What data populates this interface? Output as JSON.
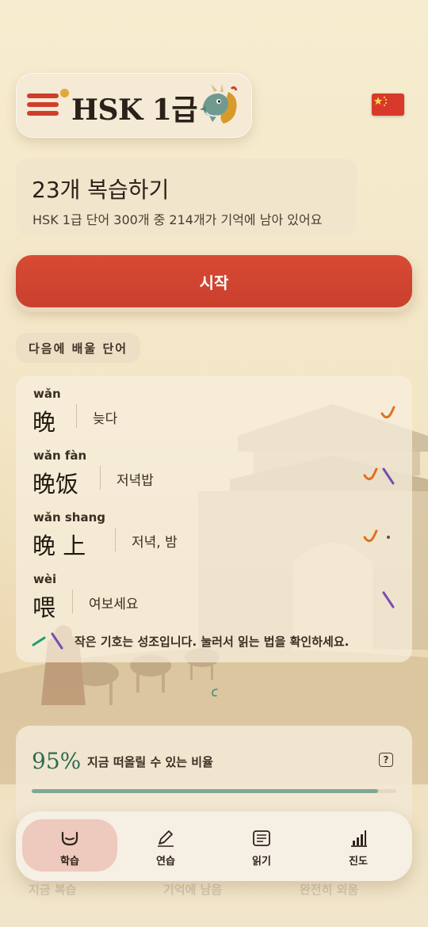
{
  "header": {
    "app_title": "HSK 1급",
    "menu_icon": "menu-icon",
    "mascot_icon": "dragon-icon",
    "language_flag": "china-flag-icon"
  },
  "review": {
    "title": "23개 복습하기",
    "subtitle": "HSK 1급 단어 300개 중 214개가 기억에 남아 있어요"
  },
  "start_button": {
    "label": "시작"
  },
  "next_words": {
    "heading": "다음에 배울 단어",
    "words": [
      {
        "pinyin": "wǎn",
        "hanzi": "晚",
        "meaning": "늦다",
        "tones": [
          "third"
        ]
      },
      {
        "pinyin": "wǎn fàn",
        "hanzi": "晚饭",
        "meaning": "저녁밥",
        "tones": [
          "third",
          "fourth"
        ]
      },
      {
        "pinyin": "wǎn shang",
        "hanzi": "晚 上",
        "meaning": "저녁, 밤",
        "tones": [
          "third",
          "neutral"
        ]
      },
      {
        "pinyin": "wèi",
        "hanzi": "喂",
        "meaning": "여보세요",
        "tones": [
          "fourth"
        ]
      }
    ],
    "legend": "작은 기호는 성조입니다. 눌러서 읽는 법을 확인하세요."
  },
  "recall": {
    "percent": "95%",
    "label": "지금 떠올릴 수 있는 비율",
    "progress": 0.95
  },
  "ghost_labels": [
    "지금 복습",
    "기억에 남음",
    "완전히 외움"
  ],
  "nav": [
    {
      "label": "학습",
      "icon": "mouth-icon",
      "active": true
    },
    {
      "label": "연습",
      "icon": "pencil-icon",
      "active": false
    },
    {
      "label": "읽기",
      "icon": "reading-icon",
      "active": false
    },
    {
      "label": "진도",
      "icon": "chart-icon",
      "active": false
    }
  ],
  "colors": {
    "accent_red": "#cf3e2c",
    "third_tone": "#e0701e",
    "fourth_tone": "#7a4bb0",
    "second_tone": "#1f9b73",
    "recall_green": "#2f6a55"
  }
}
